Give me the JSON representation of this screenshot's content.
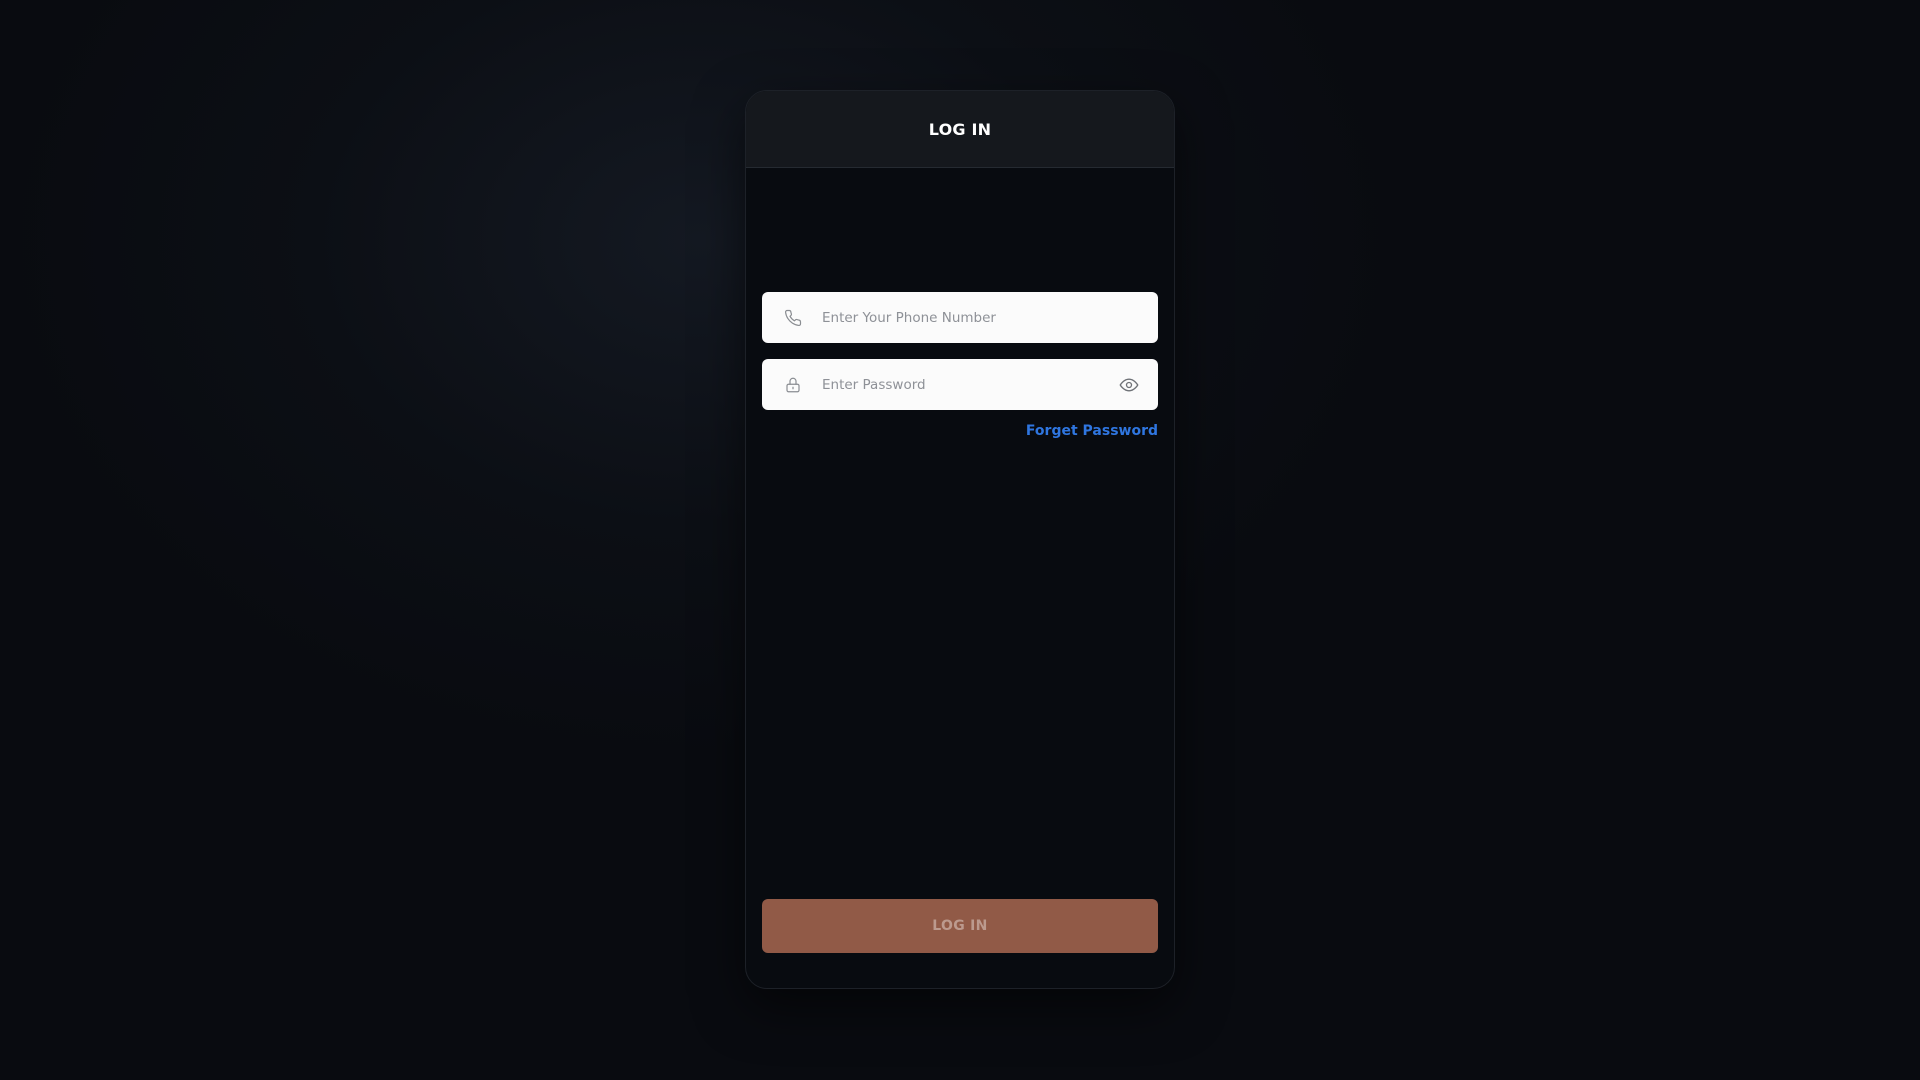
{
  "header": {
    "title": "LOG IN"
  },
  "form": {
    "phone": {
      "placeholder": "Enter Your Phone Number",
      "value": "",
      "icon": "phone-icon"
    },
    "password": {
      "placeholder": "Enter Password",
      "value": "",
      "icon": "lock-icon",
      "toggle_icon": "eye-icon"
    },
    "forget_link": "Forget Password",
    "submit_label": "LOG IN"
  },
  "colors": {
    "link": "#2f76e0",
    "button": "#915a47",
    "button_text": "#bc9a8e",
    "header_bg": "#15181d",
    "card_bg": "#080b10"
  }
}
